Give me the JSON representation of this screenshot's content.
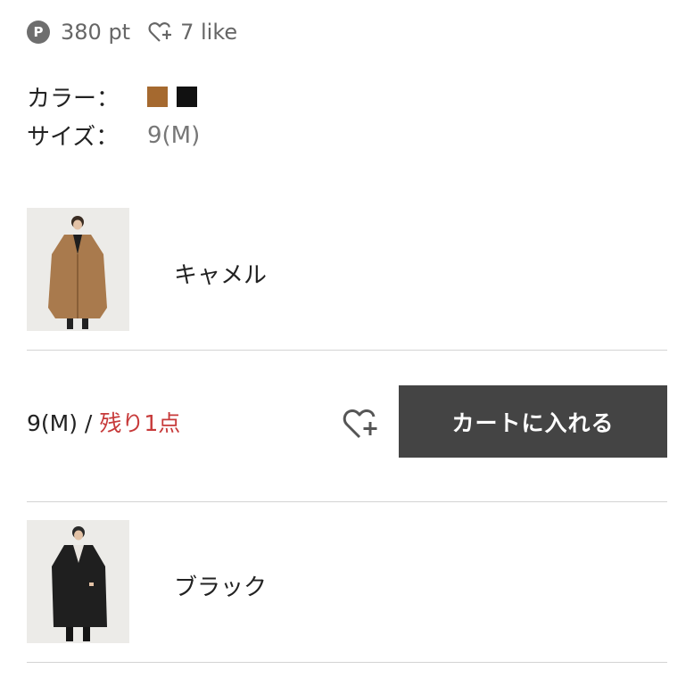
{
  "header": {
    "points_badge": "P",
    "points_text": "380 pt",
    "like_text": "7 like"
  },
  "specs": {
    "color_label": "カラー：",
    "color_swatches": [
      "#a5692f",
      "#111111"
    ],
    "size_label": "サイズ：",
    "size_value": "9(M)"
  },
  "variants": [
    {
      "name": "キャメル",
      "coat_color": "#a97a4d"
    },
    {
      "name": "ブラック",
      "coat_color": "#1f1f1f"
    }
  ],
  "stock_row": {
    "size": "9(M)",
    "separator": " / ",
    "stock_note": "残り1点",
    "cart_button_label": "カートに入れる"
  },
  "icons": {
    "points": "points-badge-icon",
    "like": "heart-plus-icon",
    "wishlist": "heart-plus-icon"
  },
  "colors": {
    "cart_button_bg": "#444444",
    "stock_warning": "#c73a3a"
  }
}
